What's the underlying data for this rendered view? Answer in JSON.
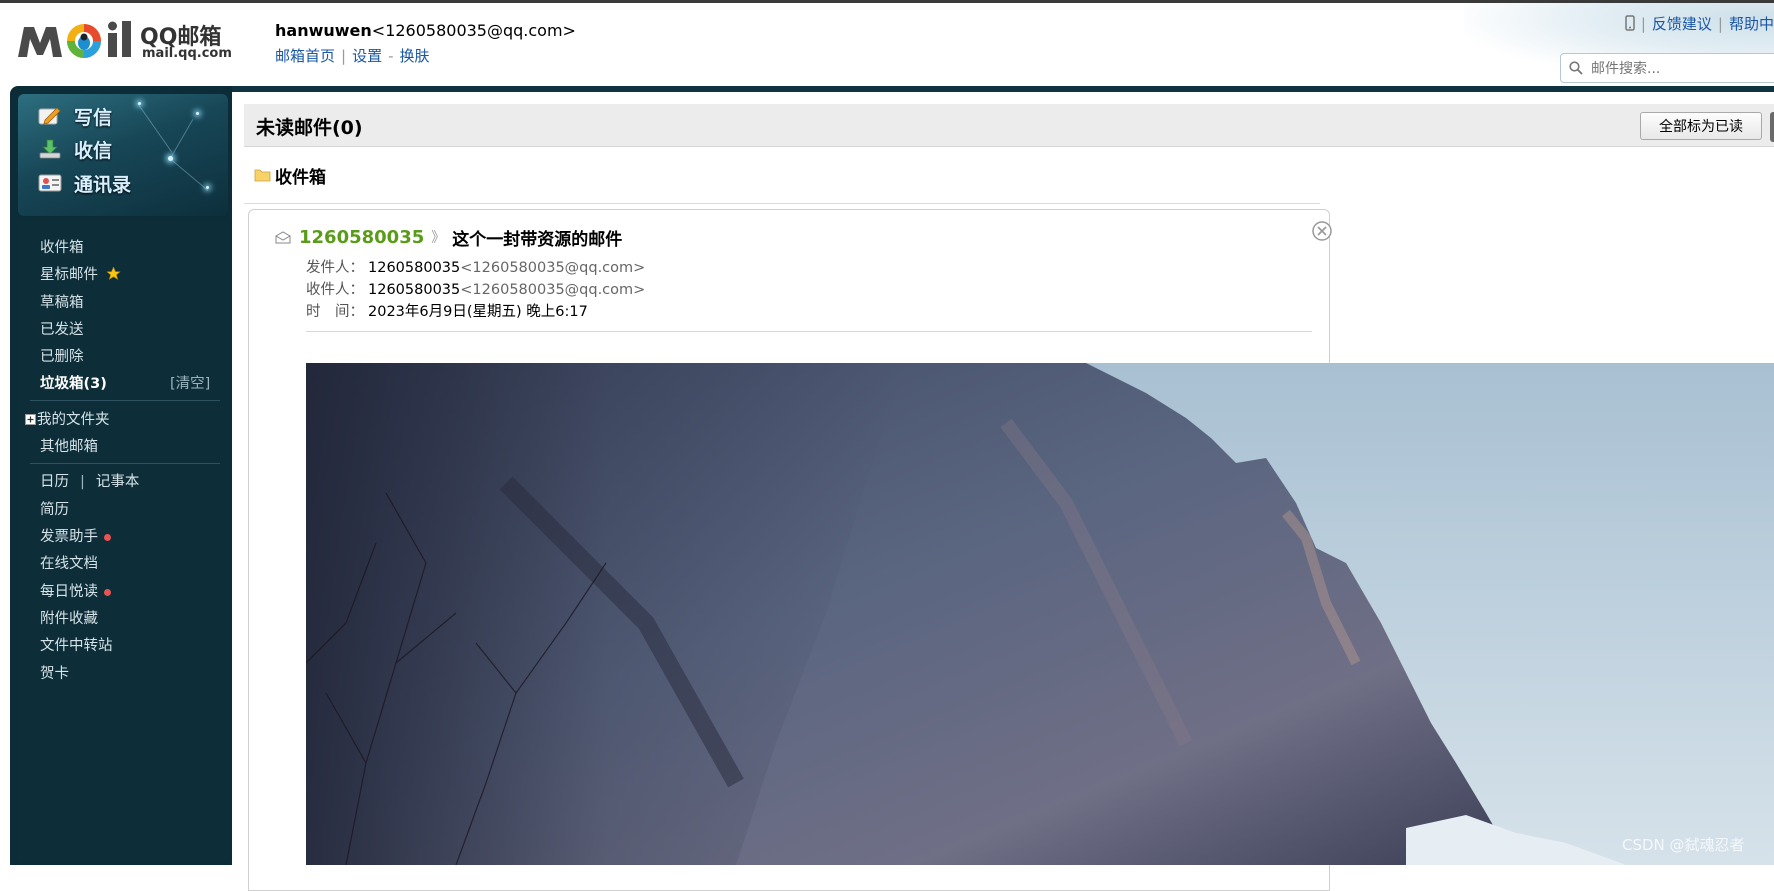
{
  "header": {
    "logo_primary": "MOil",
    "logo_brand": "QQ邮箱",
    "logo_domain": "mail.qq.com",
    "account_name": "hanwuwen",
    "account_email": "<1260580035@qq.com>",
    "links": [
      "邮箱首页",
      "设置",
      "换肤"
    ],
    "top_links": [
      "反馈建议",
      "帮助中"
    ],
    "search_placeholder": "邮件搜索..."
  },
  "sidebar": {
    "actions": [
      "写信",
      "收信",
      "通讯录"
    ],
    "folders": {
      "inbox": "收件箱",
      "starred": "星标邮件",
      "drafts": "草稿箱",
      "sent": "已发送",
      "deleted": "已删除",
      "spam": "垃圾箱(3)",
      "spam_clear": "[清空]",
      "my_folders": "我的文件夹",
      "other_mailbox": "其他邮箱"
    },
    "tools": {
      "calendar": "日历",
      "calendar_sep": "|",
      "notes": "记事本",
      "resume": "简历",
      "invoice": "发票助手",
      "docs": "在线文档",
      "daily_read": "每日悦读",
      "attachments": "附件收藏",
      "file_transfer": "文件中转站",
      "cards": "贺卡"
    }
  },
  "main": {
    "unread_title": "未读邮件(0)",
    "mark_all_read": "全部标为已读",
    "folder_label": "收件箱",
    "email": {
      "sender": "1260580035",
      "separator": "》",
      "subject": "这个一封带资源的邮件",
      "from_label": "发件人：",
      "from_name": "1260580035",
      "from_email": "<1260580035@qq.com>",
      "to_label": "收件人：",
      "to_name": "1260580035",
      "to_email": "<1260580035@qq.com>",
      "time_label": "时　间：",
      "time_value": "2023年6月9日(星期五) 晚上6:17"
    }
  },
  "watermark": "CSDN @弑魂忍者",
  "colors": {
    "sidebar_bg": "#0c2c37",
    "link": "#1a57a5",
    "sender_green": "#5a9b1a",
    "red_dot": "#e85454"
  }
}
